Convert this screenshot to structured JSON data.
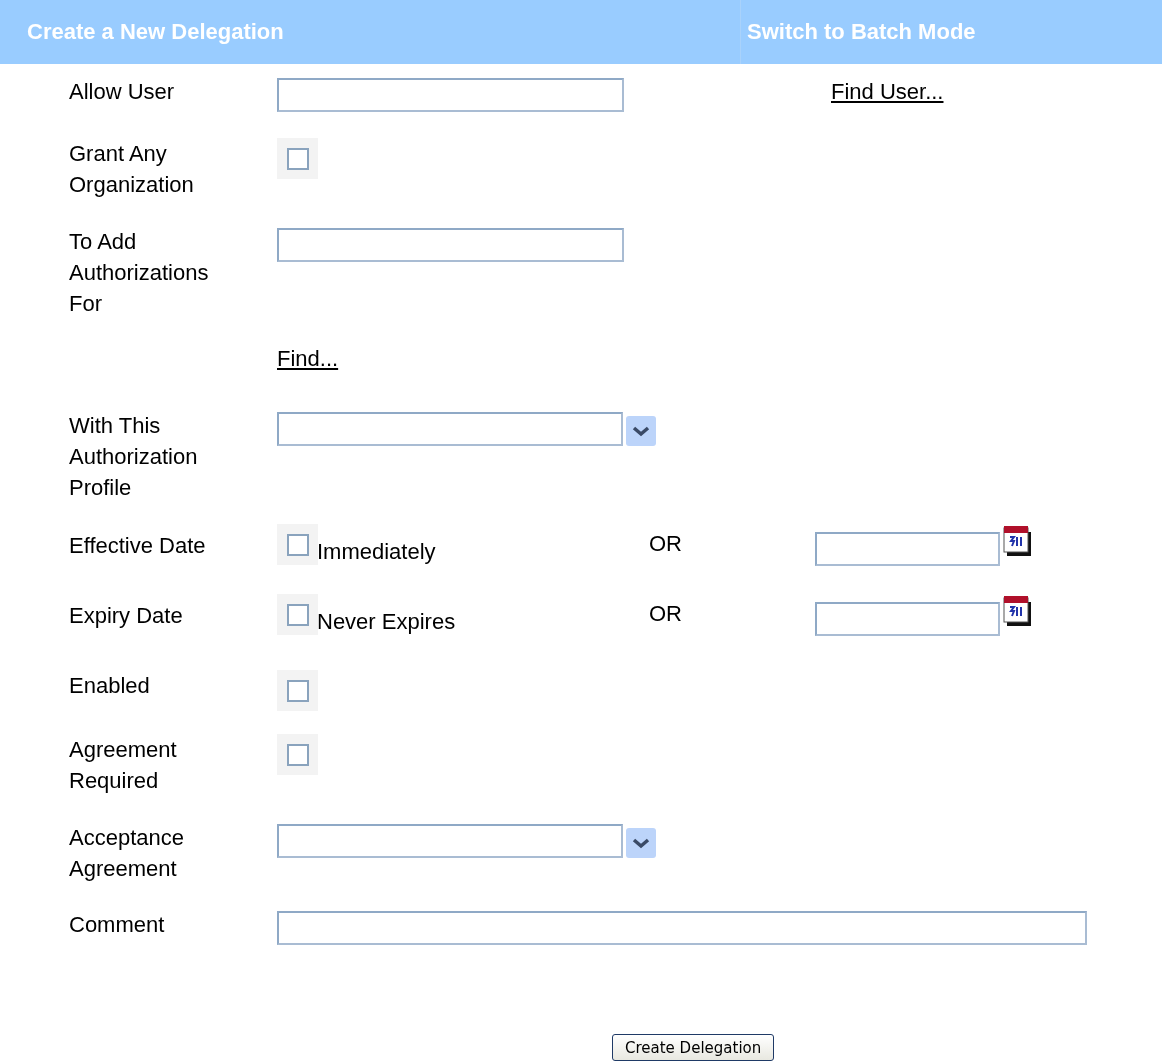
{
  "header": {
    "title": "Create a New Delegation",
    "batch_link": "Switch to Batch Mode"
  },
  "rows": [
    {
      "kind": "text",
      "label": "Allow User",
      "link": "Find User..."
    },
    {
      "kind": "checkbox",
      "label": "Grant Any Organization",
      "checked": false
    },
    {
      "kind": "text",
      "label": "To Add Authorizations For"
    },
    {
      "kind": "find",
      "link": "Find..."
    },
    {
      "kind": "select",
      "label": "With This Authorization Profile"
    },
    {
      "kind": "date",
      "label": "Effective Date",
      "option": "Immediately",
      "checked": false,
      "or": "OR"
    },
    {
      "kind": "date",
      "label": "Expiry Date",
      "option": "Never Expires",
      "checked": false,
      "or": "OR"
    },
    {
      "kind": "checkbox",
      "label": "Enabled",
      "checked": false
    },
    {
      "kind": "checkbox",
      "label": "Agreement Required",
      "checked": false
    },
    {
      "kind": "select",
      "label": "Acceptance Agreement"
    },
    {
      "kind": "comment",
      "label": "Comment"
    }
  ],
  "submit": "Create Delegation"
}
